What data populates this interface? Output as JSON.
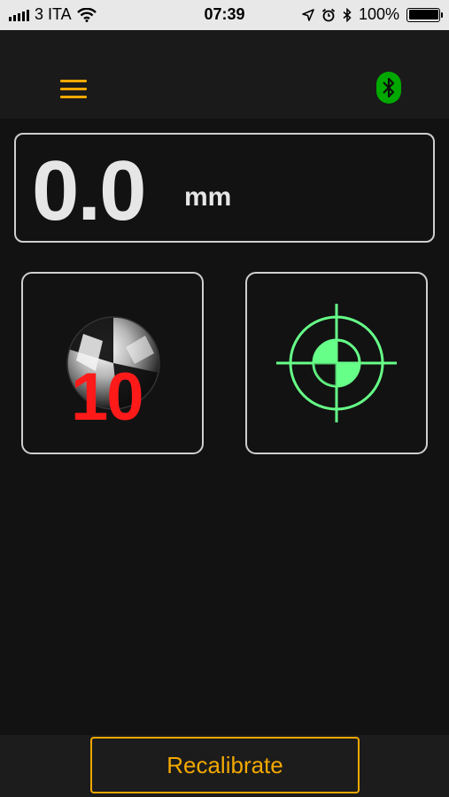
{
  "status_bar": {
    "carrier": "3 ITA",
    "time": "07:39",
    "battery_percent": "100%",
    "battery_level": 1.0,
    "icons": [
      "signal-icon",
      "wifi-icon",
      "location-icon",
      "alarm-icon",
      "bluetooth-icon",
      "battery-icon"
    ]
  },
  "nav": {
    "menu_icon": "hamburger-menu-icon",
    "bluetooth_icon": "bluetooth-connected-icon",
    "accent_color": "#f2a800",
    "bluetooth_color": "#00a800"
  },
  "measurement": {
    "value": "0.0",
    "unit": "mm"
  },
  "tools": {
    "ball": {
      "icon": "ball-target-icon",
      "count": "10",
      "count_color": "#ff1a1a"
    },
    "target": {
      "icon": "crosshair-target-icon",
      "color": "#66ff88"
    }
  },
  "footer": {
    "recalibrate_label": "Recalibrate"
  }
}
